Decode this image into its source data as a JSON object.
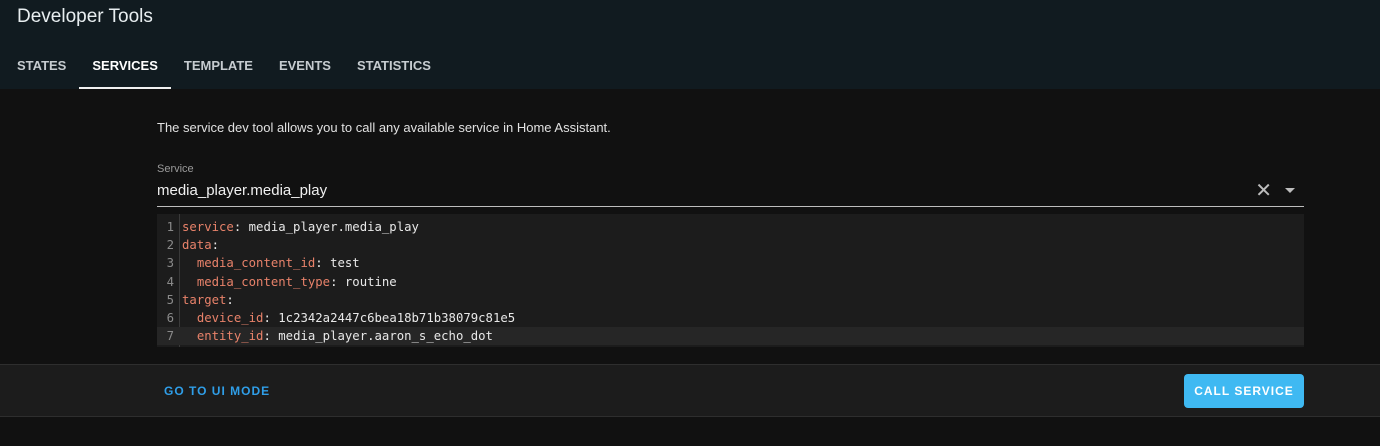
{
  "header": {
    "title": "Developer Tools",
    "tabs": [
      {
        "label": "STATES",
        "active": false
      },
      {
        "label": "SERVICES",
        "active": true
      },
      {
        "label": "TEMPLATE",
        "active": false
      },
      {
        "label": "EVENTS",
        "active": false
      },
      {
        "label": "STATISTICS",
        "active": false
      }
    ]
  },
  "main": {
    "description": "The service dev tool allows you to call any available service in Home Assistant.",
    "service_label": "Service",
    "service_value": "media_player.media_play",
    "editor": {
      "lines": [
        {
          "num": "1",
          "key": "service",
          "sep": ": ",
          "value": "media_player.media_play",
          "indent": ""
        },
        {
          "num": "2",
          "key": "data",
          "sep": ":",
          "value": "",
          "indent": ""
        },
        {
          "num": "3",
          "key": "media_content_id",
          "sep": ": ",
          "value": "test",
          "indent": "  "
        },
        {
          "num": "4",
          "key": "media_content_type",
          "sep": ": ",
          "value": "routine",
          "indent": "  "
        },
        {
          "num": "5",
          "key": "target",
          "sep": ":",
          "value": "",
          "indent": ""
        },
        {
          "num": "6",
          "key": "device_id",
          "sep": ": ",
          "value": "1c2342a2447c6bea18b71b38079c81e5",
          "indent": "  "
        },
        {
          "num": "7",
          "key": "entity_id",
          "sep": ": ",
          "value": "media_player.aaron_s_echo_dot",
          "indent": "  "
        }
      ]
    }
  },
  "footer": {
    "ui_mode_label": "GO TO UI MODE",
    "call_service_label": "CALL SERVICE"
  },
  "colors": {
    "accent": "#3fb9f2",
    "link": "#2f9ee8",
    "yaml_key": "#e8826a"
  }
}
